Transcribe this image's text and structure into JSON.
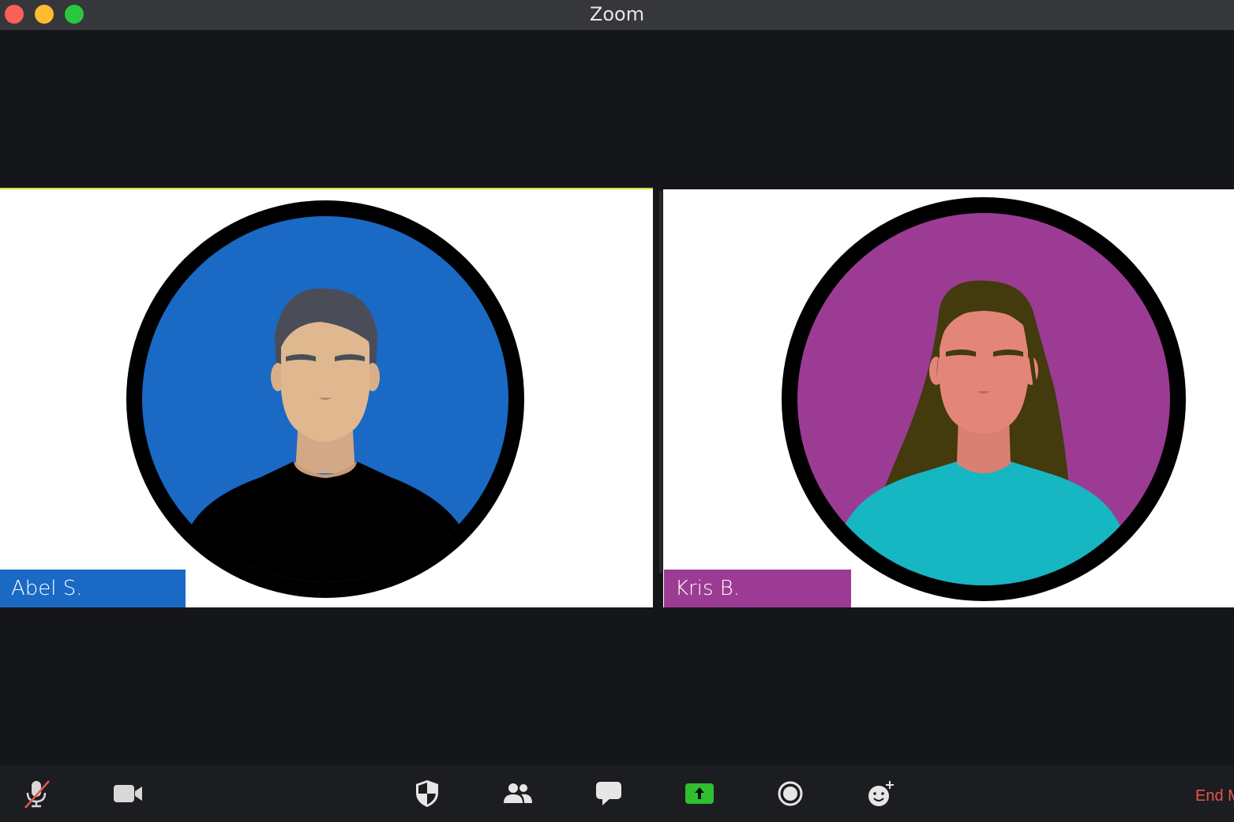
{
  "window": {
    "title": "Zoom"
  },
  "participants": [
    {
      "name": "Abel S.",
      "color": "#1a69c4",
      "shirt": "#000000"
    },
    {
      "name": "Kris B.",
      "color": "#9c3b94",
      "shirt": "#16b6c2"
    }
  ],
  "toolbar": {
    "items": [
      {
        "icon": "muted-microphone-icon",
        "name": "mute"
      },
      {
        "icon": "video-camera-icon",
        "name": "video"
      },
      {
        "icon": "shield-icon",
        "name": "security"
      },
      {
        "icon": "participants-icon",
        "name": "participants"
      },
      {
        "icon": "chat-bubble-icon",
        "name": "chat"
      },
      {
        "icon": "share-screen-icon",
        "name": "share"
      },
      {
        "icon": "record-icon",
        "name": "record"
      },
      {
        "icon": "reactions-icon",
        "name": "reactions"
      }
    ],
    "end_label": "End M",
    "share_color": "#2fbf2f",
    "end_color": "#e8554e"
  }
}
